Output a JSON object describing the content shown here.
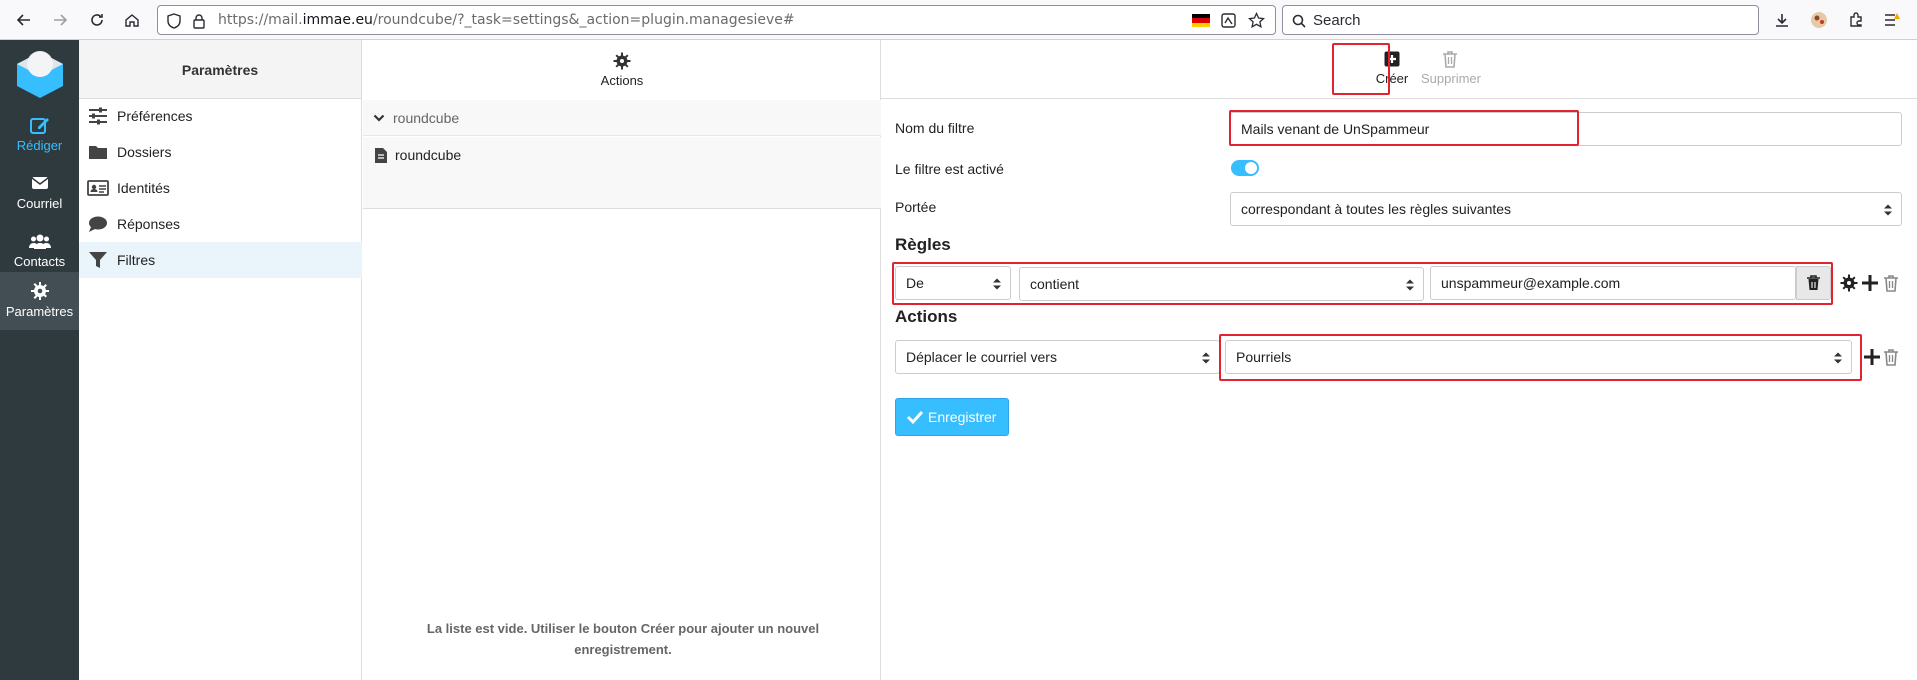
{
  "browser": {
    "url_prefix": "https://mail.",
    "url_host": "immae.eu",
    "url_path": "/roundcube/?_task=settings&_action=plugin.managesieve#",
    "search_placeholder": "Search"
  },
  "nav": {
    "compose": "Rédiger",
    "mail": "Courriel",
    "contacts": "Contacts",
    "settings": "Paramètres"
  },
  "settings": {
    "title": "Paramètres",
    "items": [
      {
        "label": "Préférences",
        "icon": "sliders-icon"
      },
      {
        "label": "Dossiers",
        "icon": "folder-icon"
      },
      {
        "label": "Identités",
        "icon": "id-card-icon"
      },
      {
        "label": "Réponses",
        "icon": "comment-icon"
      },
      {
        "label": "Filtres",
        "icon": "filter-icon"
      }
    ]
  },
  "filtersets": {
    "actions_label": "Actions",
    "set_header": "roundcube",
    "set_name": "roundcube",
    "empty_message": "La liste est vide. Utiliser le bouton Créer pour ajouter un nouvel enregistrement."
  },
  "toolbar": {
    "create": "Créer",
    "delete": "Supprimer"
  },
  "form": {
    "name_label": "Nom du filtre",
    "name_value": "Mails venant de UnSpammeur",
    "enabled_label": "Le filtre est activé",
    "scope_label": "Portée",
    "scope_value": "correspondant à toutes les règles suivantes",
    "rules_title": "Règles",
    "rule_header": "De",
    "rule_operator": "contient",
    "rule_value": "unspammeur@example.com",
    "actions_title": "Actions",
    "action_type": "Déplacer le courriel vers",
    "action_target": "Pourriels",
    "save": "Enregistrer"
  },
  "colors": {
    "accent": "#37beff",
    "sidebar": "#2f3a3f",
    "highlight": "#e0232e"
  }
}
